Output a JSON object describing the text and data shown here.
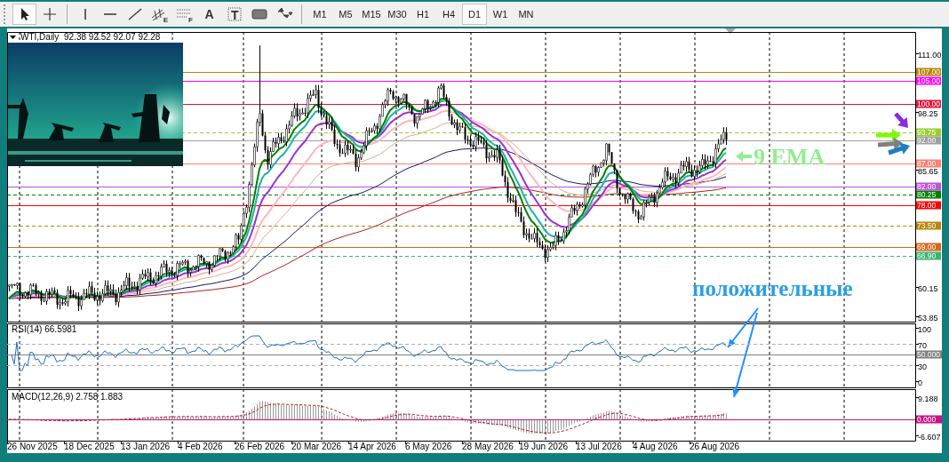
{
  "toolbar": {
    "tools": [
      {
        "kind": "cursor",
        "selected": true
      },
      {
        "kind": "crosshair",
        "selected": false
      },
      {
        "kind": "separator"
      },
      {
        "kind": "vline",
        "selected": false
      },
      {
        "kind": "hline",
        "selected": false
      },
      {
        "kind": "trendline",
        "selected": false
      },
      {
        "kind": "channel",
        "glyph": "E",
        "selected": false
      },
      {
        "kind": "fibo",
        "glyph": "F",
        "selected": false
      },
      {
        "kind": "text",
        "glyph": "A",
        "selected": false
      },
      {
        "kind": "label",
        "glyph": "T",
        "selected": false
      },
      {
        "kind": "rectangle",
        "selected": false
      },
      {
        "kind": "arrows",
        "selected": false
      },
      {
        "kind": "separator"
      }
    ],
    "timeframes": [
      {
        "label": "M1",
        "selected": false
      },
      {
        "label": "M5",
        "selected": false
      },
      {
        "label": "M15",
        "selected": false
      },
      {
        "label": "M30",
        "selected": false
      },
      {
        "label": "H1",
        "selected": false
      },
      {
        "label": "H4",
        "selected": false
      },
      {
        "label": "D1",
        "selected": true
      },
      {
        "label": "W1",
        "selected": false
      },
      {
        "label": "MN",
        "selected": false
      }
    ]
  },
  "chart": {
    "symbol": "WTI,Daily",
    "ohlc": "92.38 92.52 92.07 92.28",
    "price_ticks": [
      "111.00",
      "98.25",
      "85.65",
      "60.15",
      "53.85"
    ],
    "levels": [
      {
        "label": "107.00",
        "color": "#b8860b",
        "dashed": false
      },
      {
        "label": "105.00",
        "color": "#ff00ff",
        "dashed": false
      },
      {
        "label": "100.00",
        "color": "#dc143c",
        "dashed": false
      },
      {
        "label": "93.75",
        "color": "#9acd32",
        "dashed": true
      },
      {
        "label": "92.00",
        "color": "#a0a0a0",
        "dashed": false
      },
      {
        "label": "87.00",
        "color": "#fa8072",
        "dashed": false
      },
      {
        "label": "82.00",
        "color": "#ba55d3",
        "dashed": false
      },
      {
        "label": "80.25",
        "color": "#008000",
        "dashed": true
      },
      {
        "label": "78.00",
        "color": "#ff0000",
        "dashed": false
      },
      {
        "label": "73.50",
        "color": "#b8860b",
        "dashed": true
      },
      {
        "label": "69.00",
        "color": "#d2691e",
        "dashed": false
      },
      {
        "label": "66.90",
        "color": "#3cb371",
        "dashed": true
      }
    ],
    "markers": [
      {
        "color": "#8a2be2"
      },
      {
        "color": "#7cfc00"
      },
      {
        "color": "#808080"
      },
      {
        "color": "#1e7fc0"
      }
    ],
    "annotations": [
      {
        "kind": "ema",
        "text": "9 EMA"
      },
      {
        "kind": "note",
        "text": "положительные"
      }
    ],
    "rsi": {
      "label": "RSI(14) 66.5981",
      "ticks": [
        "100",
        "70",
        "30",
        "0"
      ],
      "middle": "50.000"
    },
    "macd": {
      "label": "MACD(12,26,9) 2.758 1.883",
      "ticks": [
        "9.188",
        "-6.607"
      ],
      "zero": "0.000"
    },
    "dates": [
      "26 Nov 2025",
      "18 Dec 2025",
      "13 Jan 2026",
      "4 Feb 2026",
      "26 Feb 2026",
      "20 Mar 2026",
      "14 Apr 2026",
      "6 May 2026",
      "28 May 2026",
      "19 Jun 2026",
      "13 Jul 2026",
      "4 Aug 2026",
      "26 Aug 2026"
    ]
  }
}
